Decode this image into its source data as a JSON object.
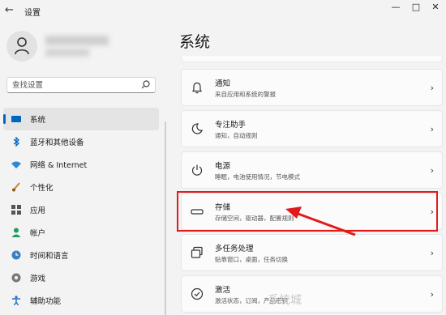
{
  "window": {
    "title": "设置",
    "back_icon": "back-arrow-icon"
  },
  "user": {
    "name": "",
    "email": ""
  },
  "search": {
    "placeholder": "查找设置"
  },
  "nav": [
    {
      "label": "系统",
      "icon": "display-icon",
      "active": true
    },
    {
      "label": "蓝牙和其他设备",
      "icon": "bluetooth-icon"
    },
    {
      "label": "网络 & Internet",
      "icon": "wifi-icon"
    },
    {
      "label": "个性化",
      "icon": "brush-icon"
    },
    {
      "label": "应用",
      "icon": "apps-icon"
    },
    {
      "label": "帐户",
      "icon": "account-icon"
    },
    {
      "label": "时间和语言",
      "icon": "globe-clock-icon"
    },
    {
      "label": "游戏",
      "icon": "gamepad-icon"
    },
    {
      "label": "辅助功能",
      "icon": "accessibility-icon"
    }
  ],
  "main": {
    "title": "系统",
    "cards": [
      {
        "title": "通知",
        "desc": "来自应用和系统的警报",
        "icon": "bell-icon"
      },
      {
        "title": "专注助手",
        "desc": "通知，自动规则",
        "icon": "moon-icon"
      },
      {
        "title": "电源",
        "desc": "睡眠，电池使用情况，节电模式",
        "icon": "power-icon"
      },
      {
        "title": "存储",
        "desc": "存储空间，驱动器，配置规则",
        "icon": "storage-icon"
      },
      {
        "title": "多任务处理",
        "desc": "贴靠窗口，桌面，任务切换",
        "icon": "multitask-icon"
      },
      {
        "title": "激活",
        "desc": "激活状态，订阅，产品密钥",
        "icon": "check-circle-icon"
      }
    ]
  },
  "annotation": {
    "highlight_color": "#e11b1b"
  },
  "watermark": "系统城"
}
